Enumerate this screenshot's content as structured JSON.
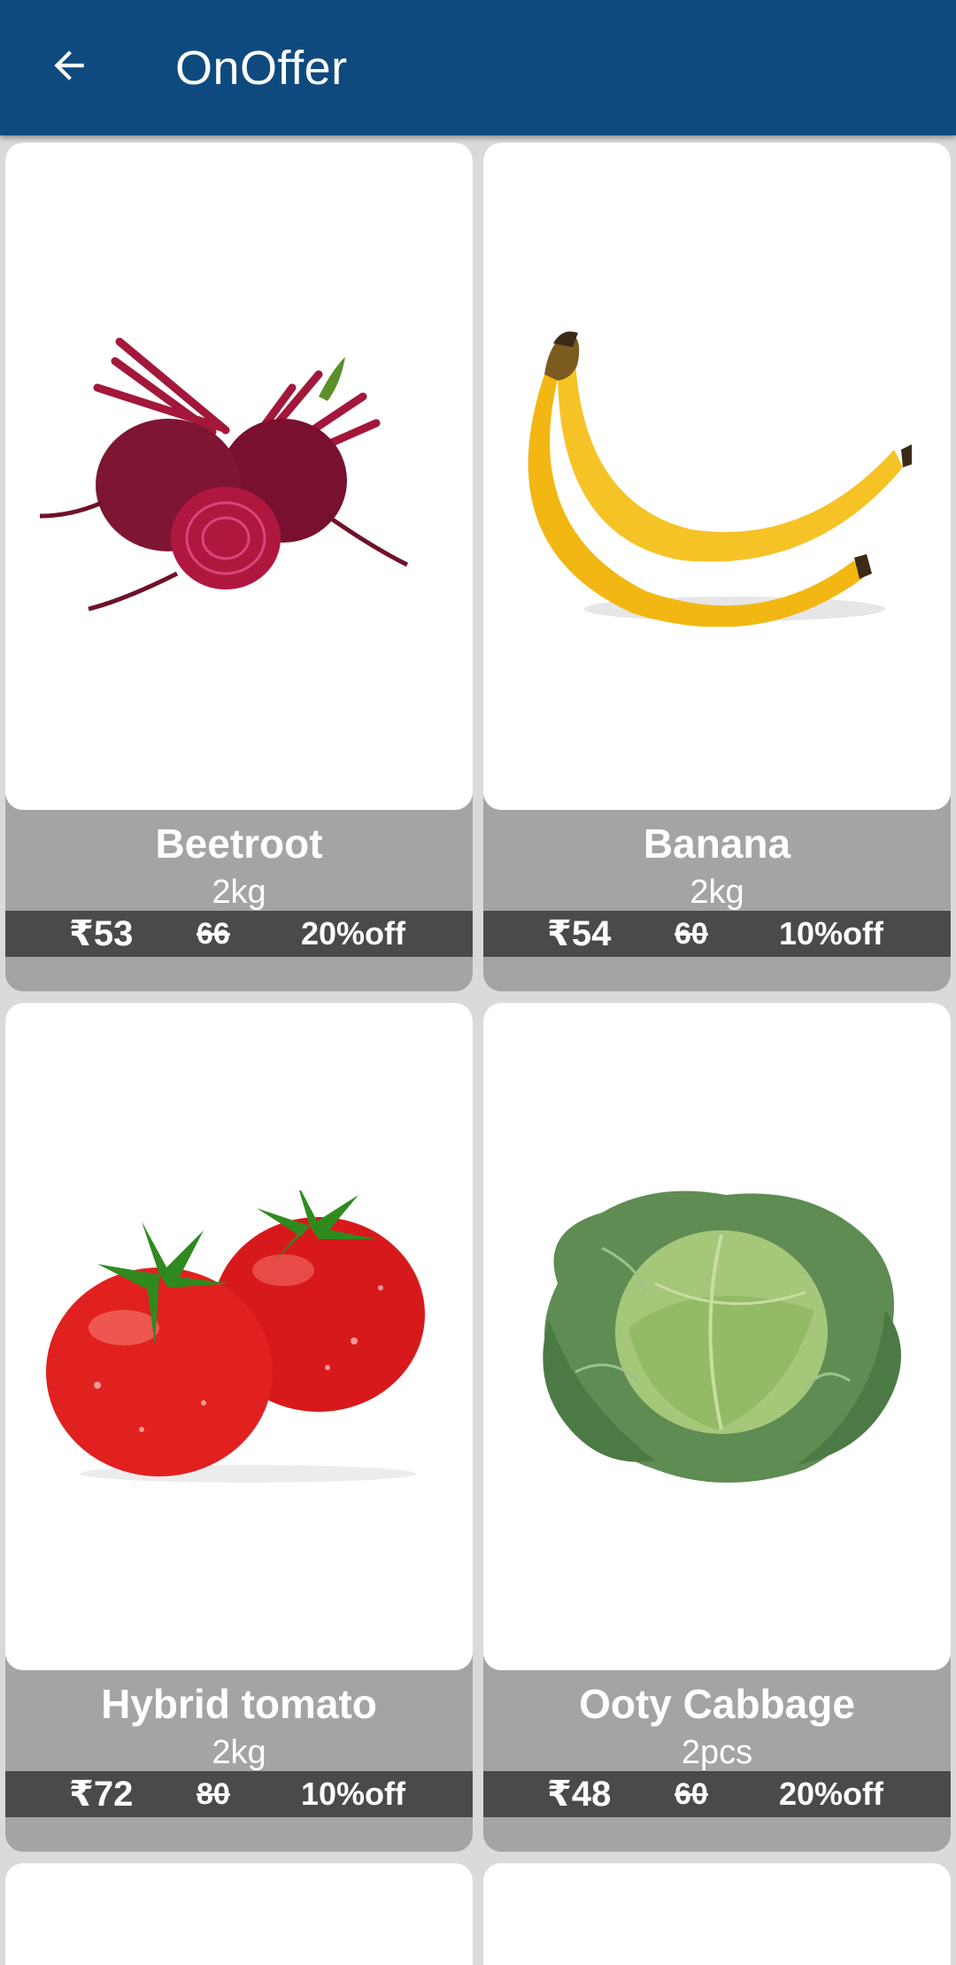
{
  "appbar": {
    "title": "OnOffer",
    "back_icon": "arrow-back-icon",
    "background_color": "#0f4a7f"
  },
  "products": [
    {
      "name": "Beetroot",
      "qty": "2kg",
      "price": "₹53",
      "mrp": "66",
      "discount": "20%off",
      "image_icon": "beetroot-image"
    },
    {
      "name": "Banana",
      "qty": "2kg",
      "price": "₹54",
      "mrp": "60",
      "discount": "10%off",
      "image_icon": "banana-image"
    },
    {
      "name": "Hybrid tomato",
      "qty": "2kg",
      "price": "₹72",
      "mrp": "80",
      "discount": "10%off",
      "image_icon": "tomato-image"
    },
    {
      "name": "Ooty Cabbage",
      "qty": "2pcs",
      "price": "₹48",
      "mrp": "60",
      "discount": "20%off",
      "image_icon": "cabbage-image"
    }
  ],
  "colors": {
    "card_info_bg": "#a4a4a4",
    "price_strip_bg": "#4a4a4a",
    "page_bg": "#dadada"
  }
}
